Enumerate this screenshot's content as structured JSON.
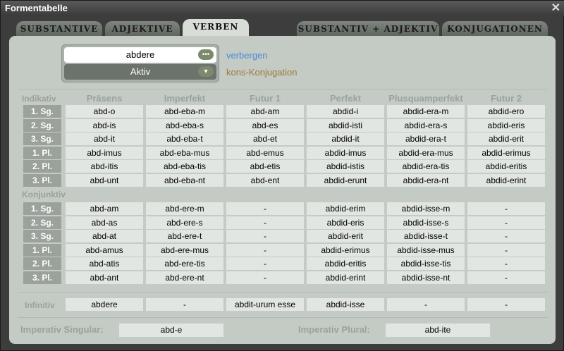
{
  "window": {
    "title": "Formentabelle",
    "close_glyph": "✕"
  },
  "tabs": [
    "Substantive",
    "Adjektive",
    "Verben",
    "Substantiv + Adjektiv",
    "Konjugationen"
  ],
  "active_tab": "Verben",
  "selector": {
    "word": "abdere",
    "voice": "Aktiv",
    "word_btn": "•••",
    "voice_btn": "▾"
  },
  "hide_link": "verbergen",
  "conjugation_label": "kons-Konjugation",
  "indikativ_label": "Indikativ",
  "konjunktiv_label": "Konjunktiv",
  "columns": [
    "Präsens",
    "Imperfekt",
    "Futur 1",
    "Perfekt",
    "Plusquamperfekt",
    "Futur 2"
  ],
  "persons": [
    "1. Sg.",
    "2. Sg.",
    "3. Sg.",
    "1. Pl.",
    "2. Pl.",
    "3. Pl."
  ],
  "indikativ": [
    [
      "abd-o",
      "abd-eba-m",
      "abd-am",
      "abdid-i",
      "abdid-era-m",
      "abdid-ero"
    ],
    [
      "abd-is",
      "abd-eba-s",
      "abd-es",
      "abdid-isti",
      "abdid-era-s",
      "abdid-eris"
    ],
    [
      "abd-it",
      "abd-eba-t",
      "abd-et",
      "abdid-it",
      "abdid-era-t",
      "abdid-erit"
    ],
    [
      "abd-imus",
      "abd-eba-mus",
      "abd-emus",
      "abdid-imus",
      "abdid-era-mus",
      "abdid-erimus"
    ],
    [
      "abd-itis",
      "abd-eba-tis",
      "abd-etis",
      "abdid-istis",
      "abdid-era-tis",
      "abdid-eritis"
    ],
    [
      "abd-unt",
      "abd-eba-nt",
      "abd-ent",
      "abdid-erunt",
      "abdid-era-nt",
      "abdid-erint"
    ]
  ],
  "konjunktiv": [
    [
      "abd-am",
      "abd-ere-m",
      "-",
      "abdid-erim",
      "abdid-isse-m",
      "-"
    ],
    [
      "abd-as",
      "abd-ere-s",
      "-",
      "abdid-eris",
      "abdid-isse-s",
      "-"
    ],
    [
      "abd-at",
      "abd-ere-t",
      "-",
      "abdid-erit",
      "abdid-isse-t",
      "-"
    ],
    [
      "abd-amus",
      "abd-ere-mus",
      "-",
      "abdid-erimus",
      "abdid-isse-mus",
      "-"
    ],
    [
      "abd-atis",
      "abd-ere-tis",
      "-",
      "abdid-eritis",
      "abdid-isse-tis",
      "-"
    ],
    [
      "abd-ant",
      "abd-ere-nt",
      "-",
      "abdid-erint",
      "abdid-isse-nt",
      "-"
    ]
  ],
  "infinitiv_label": "Infinitiv",
  "infinitiv": [
    "abdere",
    "-",
    "abdit-urum esse",
    "abdid-isse",
    "-",
    "-"
  ],
  "imperativ": {
    "singular_label": "Imperativ Singular:",
    "singular": "abd-e",
    "plural_label": "Imperativ Plural:",
    "plural": "abd-ite"
  }
}
